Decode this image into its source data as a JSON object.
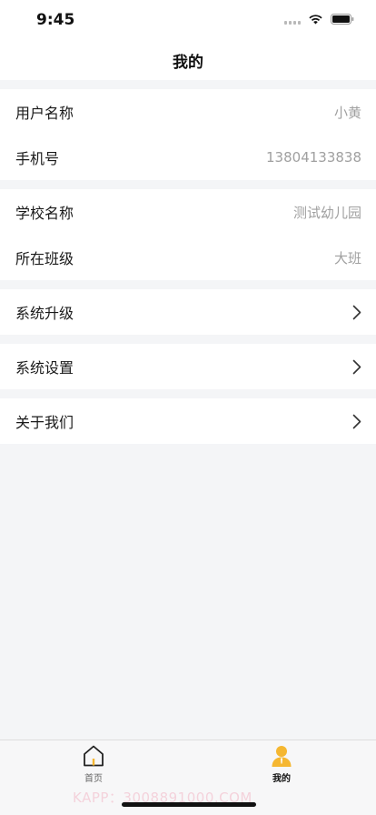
{
  "status_bar": {
    "time": "9:45"
  },
  "nav": {
    "title": "我的"
  },
  "groups": [
    {
      "rows": [
        {
          "label": "用户名称",
          "value": "小黄"
        },
        {
          "label": "手机号",
          "value": "13804133838"
        }
      ]
    },
    {
      "rows": [
        {
          "label": "学校名称",
          "value": "测试幼儿园"
        },
        {
          "label": "所在班级",
          "value": "大班"
        }
      ]
    },
    {
      "rows": [
        {
          "label": "系统升级"
        }
      ]
    },
    {
      "rows": [
        {
          "label": "系统设置"
        }
      ]
    },
    {
      "rows": [
        {
          "label": "关于我们"
        }
      ]
    }
  ],
  "tab_bar": {
    "home": {
      "label": "首页",
      "icon": "house-icon"
    },
    "mine": {
      "label": "我的",
      "icon": "person-icon"
    },
    "active_color": "#f5b731"
  },
  "watermark": "KAPP：3008891000.COM"
}
